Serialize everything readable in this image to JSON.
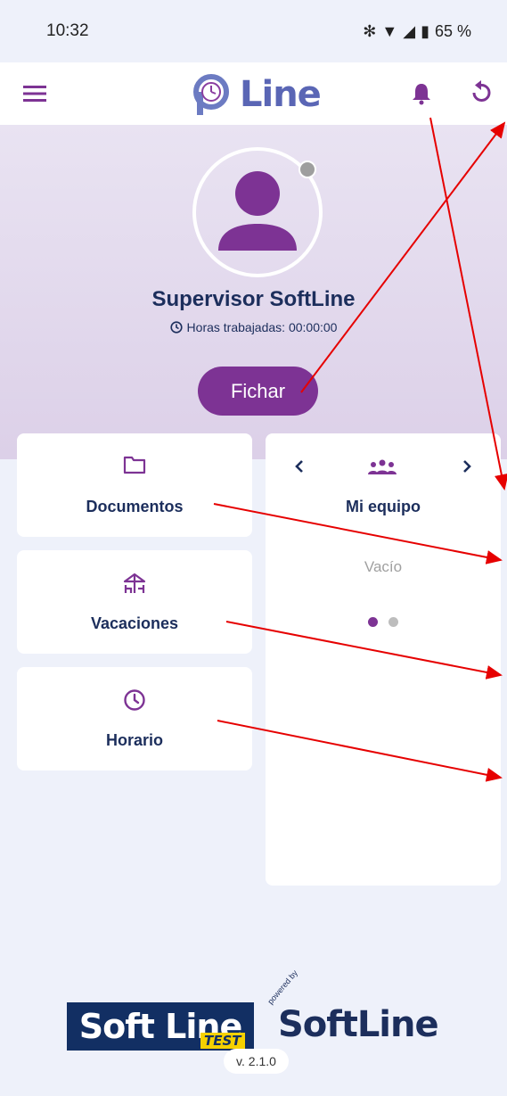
{
  "status_bar": {
    "time": "10:32",
    "battery": "65 %"
  },
  "app_bar": {
    "logo_text": "Line"
  },
  "profile": {
    "name": "Supervisor SoftLine",
    "hours_label": "Horas trabajadas: 00:00:00"
  },
  "clock_button": "Fichar",
  "menu_cards": {
    "documents": "Documentos",
    "vacations": "Vacaciones",
    "schedule": "Horario"
  },
  "team_card": {
    "title": "Mi equipo",
    "empty_text": "Vacío"
  },
  "footer": {
    "brand_left": "Soft Line",
    "brand_left_tag": "TEST",
    "brand_right_powered": "powered by",
    "brand_right": "SoftLine",
    "version": "v. 2.1.0"
  },
  "colors": {
    "accent": "#7d3394",
    "navy": "#1c2e5c",
    "background": "#eef1fa"
  }
}
